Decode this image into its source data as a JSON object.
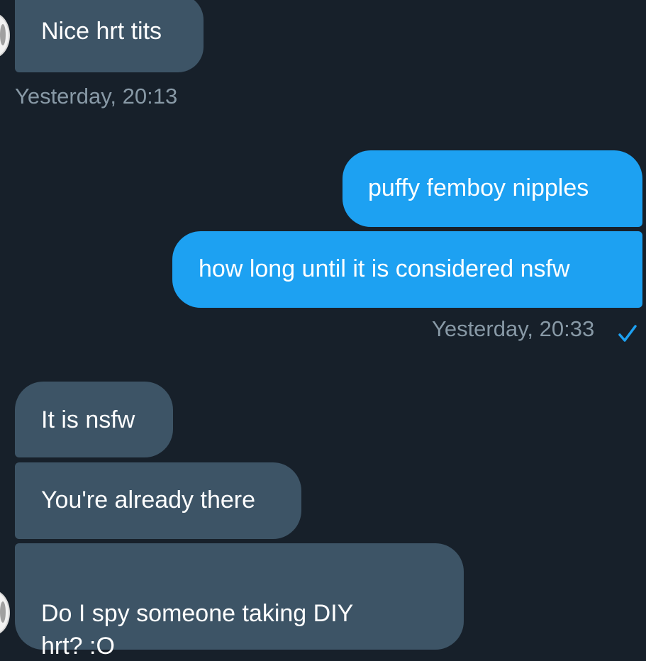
{
  "conversation": {
    "messages": [
      {
        "direction": "incoming",
        "text": "Nice hrt tits"
      },
      {
        "direction": "outgoing",
        "text": "puffy femboy nipples"
      },
      {
        "direction": "outgoing",
        "text": "how long until it is considered nsfw"
      },
      {
        "direction": "incoming",
        "text": "It is nsfw"
      },
      {
        "direction": "incoming",
        "text": "You're already there"
      },
      {
        "direction": "incoming",
        "text": "Do I spy someone taking DIY\nhrt? :O"
      }
    ],
    "timestamps": {
      "incoming_group_1": "Yesterday, 20:13",
      "outgoing_group_1": "Yesterday, 20:33"
    },
    "read_receipt_icon": "checkmark-icon",
    "colors": {
      "background": "#17202a",
      "incoming_bubble": "#3d5466",
      "outgoing_bubble": "#1da1f2",
      "timestamp_text": "#8899a6",
      "read_check": "#1da1f2"
    }
  }
}
